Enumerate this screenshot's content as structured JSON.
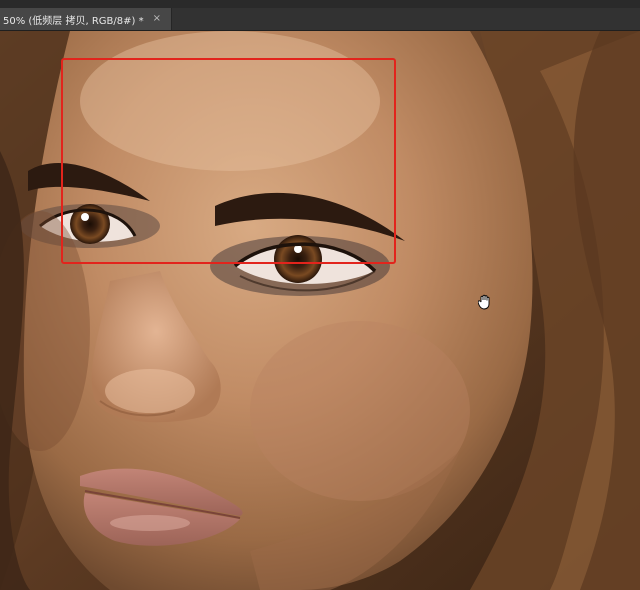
{
  "document_tab": {
    "title": "50% (低频层 拷贝, RGB/8#) *",
    "close_glyph": "×"
  },
  "annotation": {
    "color": "#e2241c"
  },
  "cursor": {
    "icon": "hand-tool-icon"
  }
}
